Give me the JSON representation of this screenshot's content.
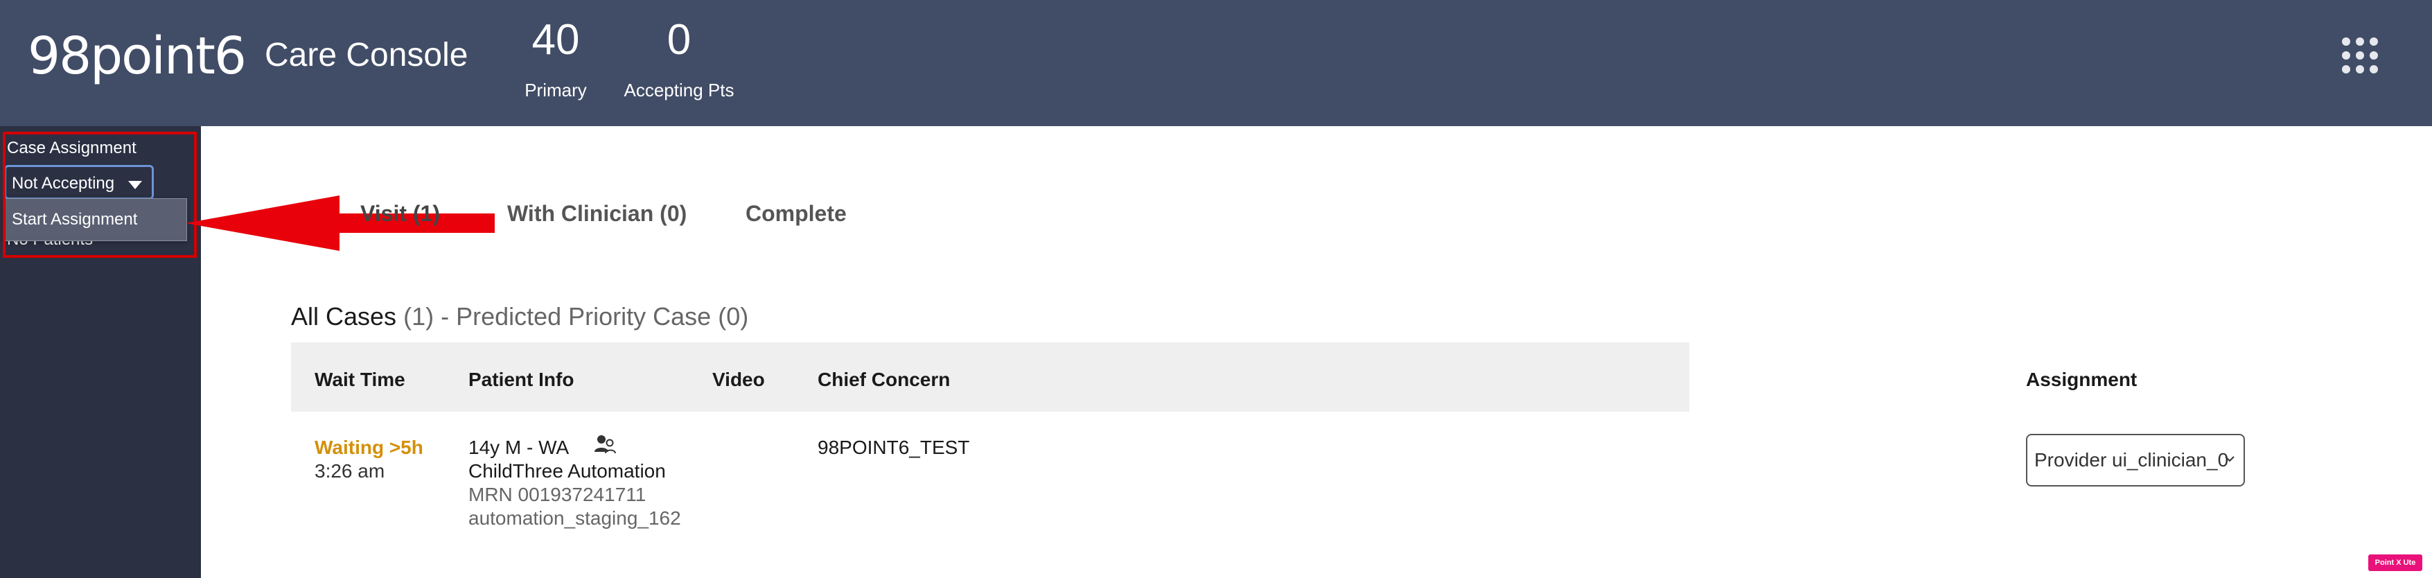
{
  "header": {
    "logo": "98point6",
    "title": "Care Console",
    "stats": [
      {
        "value": "40",
        "label": "Primary"
      },
      {
        "value": "0",
        "label": "Accepting Pts"
      }
    ]
  },
  "sidebar": {
    "case_assignment_label": "Case Assignment",
    "dropdown_value": "Not Accepting",
    "menu_option": "Start Assignment",
    "no_patients": "No Patients"
  },
  "tabs": [
    {
      "label": "Visit (1)"
    },
    {
      "label": "With Clinician (0)"
    },
    {
      "label": "Complete"
    }
  ],
  "cases": {
    "title": "All Cases",
    "count": "(1) - Predicted Priority Case (0)"
  },
  "table": {
    "headers": {
      "wait_time": "Wait Time",
      "patient_info": "Patient Info",
      "video": "Video",
      "chief_concern": "Chief Concern",
      "assignment": "Assignment"
    },
    "rows": [
      {
        "status": "Waiting >5h",
        "time": "3:26 am",
        "demographics": "14y M - WA",
        "name": "ChildThree Automation",
        "mrn": "MRN 001937241711",
        "username": "automation_staging_162",
        "chief_concern": "98POINT6_TEST",
        "assignment": "Provider ui_clinician_0"
      }
    ]
  },
  "badge": "Point X Ute",
  "colors": {
    "header_bg": "#414c66",
    "sidebar_bg": "#2b3043",
    "waiting": "#d4900a",
    "annotation": "#e8000b"
  }
}
